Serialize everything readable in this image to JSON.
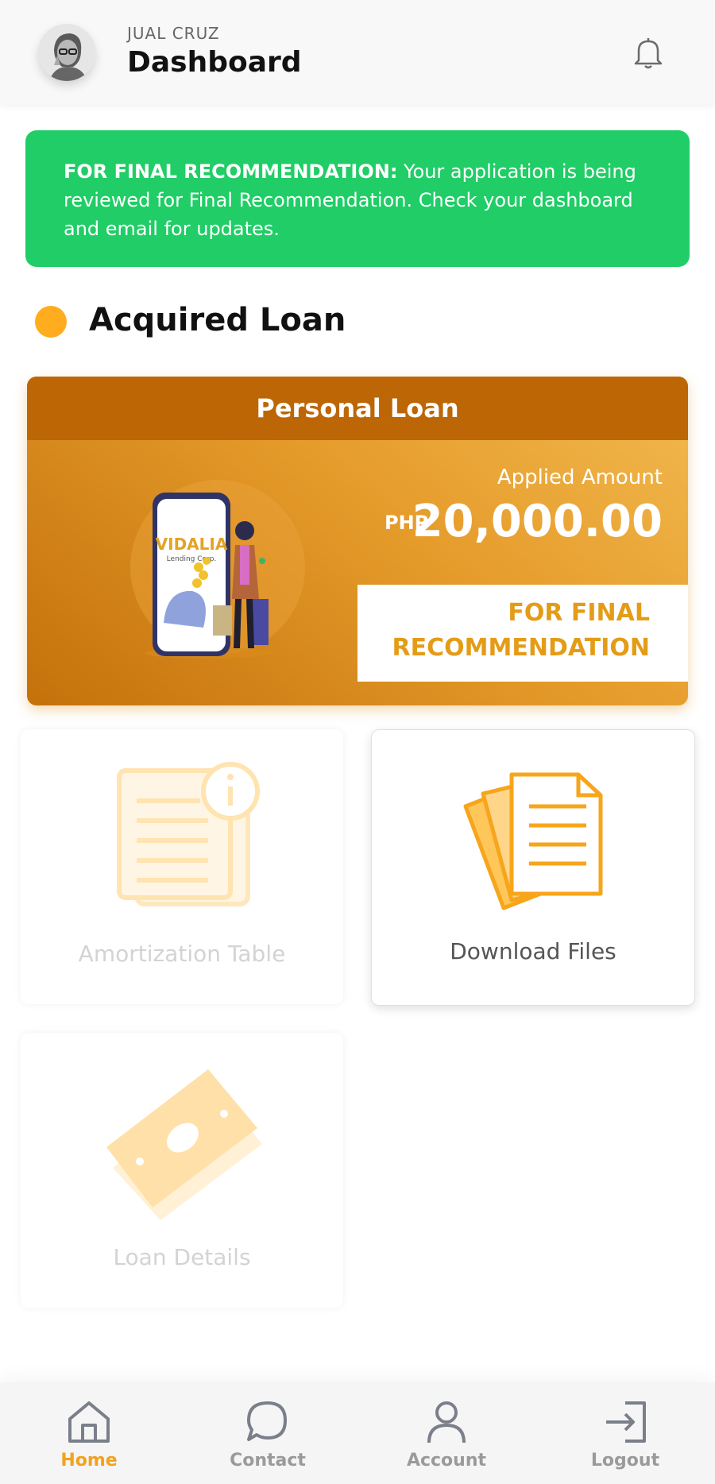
{
  "header": {
    "user_name": "JUAL CRUZ",
    "title": "Dashboard"
  },
  "banner": {
    "label": "FOR FINAL RECOMMENDATION:",
    "message": " Your application is being reviewed for Final Recommendation. Check your dashboard and email for updates."
  },
  "section": {
    "title": "Acquired Loan"
  },
  "loan_card": {
    "title": "Personal Loan",
    "brand": "VIDALIA",
    "brand_sub": "Lending Corp.",
    "applied_label": "Applied Amount",
    "currency": "PHP",
    "amount": "20,000.00",
    "status": "FOR FINAL RECOMMENDATION"
  },
  "tiles": [
    {
      "label": "Amortization Table",
      "enabled": false
    },
    {
      "label": "Download Files",
      "enabled": true
    },
    {
      "label": "Loan Details",
      "enabled": false
    }
  ],
  "nav": [
    {
      "label": "Home",
      "icon": "home-icon",
      "active": true
    },
    {
      "label": "Contact",
      "icon": "chat-icon",
      "active": false
    },
    {
      "label": "Account",
      "icon": "user-icon",
      "active": false
    },
    {
      "label": "Logout",
      "icon": "logout-icon",
      "active": false
    }
  ],
  "colors": {
    "accent": "#f3a21a",
    "banner_green": "#20cd66",
    "card_header": "#bd6606"
  }
}
